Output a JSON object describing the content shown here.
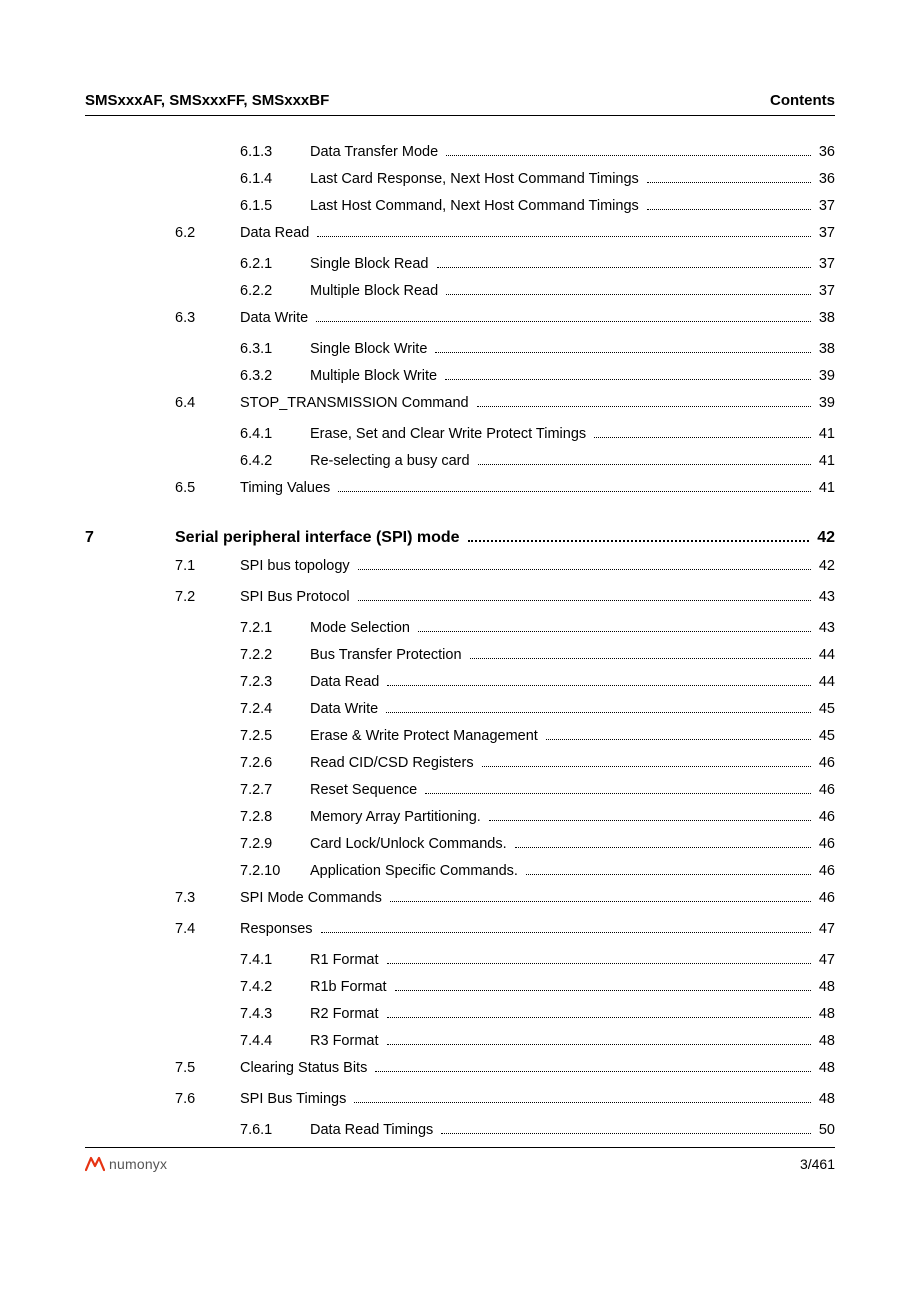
{
  "header": {
    "left": "SMSxxxAF, SMSxxxFF, SMSxxxBF",
    "right": "Contents"
  },
  "toc": [
    {
      "type": "subsub",
      "section": "",
      "sub": "6.1.3",
      "title": "Data Transfer Mode",
      "page": "36"
    },
    {
      "type": "subsub",
      "section": "",
      "sub": "6.1.4",
      "title": "Last Card Response, Next Host Command Timings",
      "page": "36"
    },
    {
      "type": "subsub",
      "section": "",
      "sub": "6.1.5",
      "title": "Last Host Command, Next Host Command Timings",
      "page": "37"
    },
    {
      "type": "section",
      "section": "6.2",
      "sub": "",
      "title": "Data Read",
      "page": "37"
    },
    {
      "type": "subsub",
      "section": "",
      "sub": "6.2.1",
      "title": "Single Block Read",
      "page": "37"
    },
    {
      "type": "subsub",
      "section": "",
      "sub": "6.2.2",
      "title": "Multiple Block Read",
      "page": "37"
    },
    {
      "type": "section",
      "section": "6.3",
      "sub": "",
      "title": "Data Write",
      "page": "38"
    },
    {
      "type": "subsub",
      "section": "",
      "sub": "6.3.1",
      "title": "Single Block Write",
      "page": "38"
    },
    {
      "type": "subsub",
      "section": "",
      "sub": "6.3.2",
      "title": "Multiple Block Write",
      "page": "39"
    },
    {
      "type": "section",
      "section": "6.4",
      "sub": "",
      "title": "STOP_TRANSMISSION Command",
      "page": "39"
    },
    {
      "type": "subsub",
      "section": "",
      "sub": "6.4.1",
      "title": "Erase, Set and Clear Write Protect Timings",
      "page": "41"
    },
    {
      "type": "subsub",
      "section": "",
      "sub": "6.4.2",
      "title": "Re-selecting a busy card",
      "page": "41"
    },
    {
      "type": "section",
      "section": "6.5",
      "sub": "",
      "title": "Timing Values",
      "page": "41"
    },
    {
      "type": "chapter",
      "chapter": "7",
      "sub": "",
      "title": "Serial peripheral interface (SPI) mode",
      "page": "42"
    },
    {
      "type": "section",
      "section": "7.1",
      "sub": "",
      "title": "SPI bus topology",
      "page": "42"
    },
    {
      "type": "section",
      "section": "7.2",
      "sub": "",
      "title": "SPI Bus Protocol",
      "page": "43"
    },
    {
      "type": "subsub",
      "section": "",
      "sub": "7.2.1",
      "title": "Mode Selection",
      "page": "43"
    },
    {
      "type": "subsub",
      "section": "",
      "sub": "7.2.2",
      "title": "Bus Transfer Protection",
      "page": "44"
    },
    {
      "type": "subsub",
      "section": "",
      "sub": "7.2.3",
      "title": "Data Read",
      "page": "44"
    },
    {
      "type": "subsub",
      "section": "",
      "sub": "7.2.4",
      "title": "Data Write",
      "page": "45"
    },
    {
      "type": "subsub",
      "section": "",
      "sub": "7.2.5",
      "title": "Erase & Write Protect Management",
      "page": "45"
    },
    {
      "type": "subsub",
      "section": "",
      "sub": "7.2.6",
      "title": "Read CID/CSD Registers",
      "page": "46"
    },
    {
      "type": "subsub",
      "section": "",
      "sub": "7.2.7",
      "title": "Reset Sequence",
      "page": "46"
    },
    {
      "type": "subsub",
      "section": "",
      "sub": "7.2.8",
      "title": "Memory Array Partitioning.",
      "page": "46"
    },
    {
      "type": "subsub",
      "section": "",
      "sub": "7.2.9",
      "title": "Card Lock/Unlock Commands.",
      "page": "46"
    },
    {
      "type": "subsub",
      "section": "",
      "sub": "7.2.10",
      "title": "Application Specific Commands.",
      "page": "46"
    },
    {
      "type": "section",
      "section": "7.3",
      "sub": "",
      "title": "SPI Mode Commands",
      "page": "46"
    },
    {
      "type": "section",
      "section": "7.4",
      "sub": "",
      "title": "Responses",
      "page": "47"
    },
    {
      "type": "subsub",
      "section": "",
      "sub": "7.4.1",
      "title": "R1 Format",
      "page": "47"
    },
    {
      "type": "subsub",
      "section": "",
      "sub": "7.4.2",
      "title": "R1b Format",
      "page": "48"
    },
    {
      "type": "subsub",
      "section": "",
      "sub": "7.4.3",
      "title": "R2 Format",
      "page": "48"
    },
    {
      "type": "subsub",
      "section": "",
      "sub": "7.4.4",
      "title": "R3 Format",
      "page": "48"
    },
    {
      "type": "section",
      "section": "7.5",
      "sub": "",
      "title": "Clearing Status Bits",
      "page": "48"
    },
    {
      "type": "section",
      "section": "7.6",
      "sub": "",
      "title": "SPI Bus Timings",
      "page": "48"
    },
    {
      "type": "subsub",
      "section": "",
      "sub": "7.6.1",
      "title": "Data Read Timings",
      "page": "50"
    }
  ],
  "footer": {
    "brand": "numonyx",
    "page_num": "3/461"
  }
}
